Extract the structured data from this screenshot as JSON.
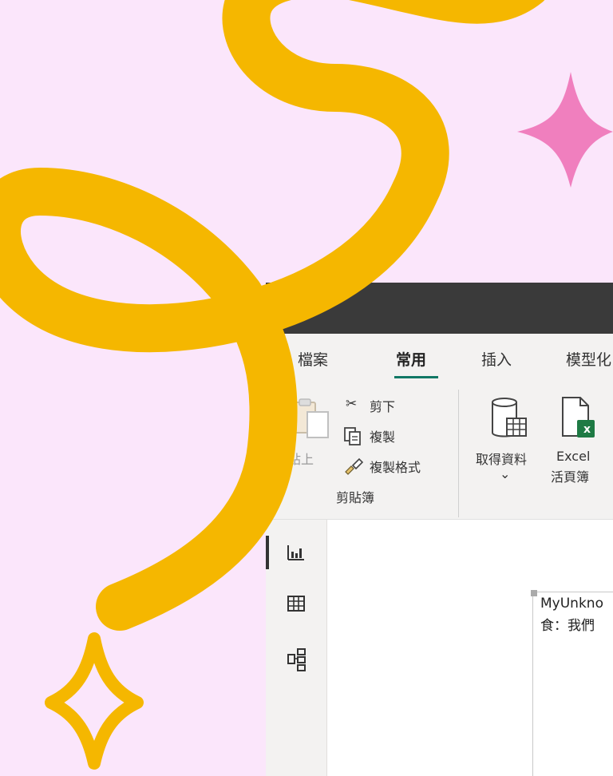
{
  "window": {
    "menu": [
      "檔案",
      "常用",
      "插入",
      "模型化"
    ],
    "active_tab": "常用"
  },
  "ribbon": {
    "paste_label": "貼上",
    "cut_label": "剪下",
    "copy_label": "複製",
    "format_painter_label": "複製格式",
    "clipboard_group_label": "剪貼簿",
    "get_data_label": "取得資料",
    "get_data_chevron": "⌄",
    "excel_label_1": "Excel",
    "excel_label_2": "活頁簿",
    "excel_badge": "x"
  },
  "rail": {
    "items": [
      "report-view",
      "data-view",
      "model-view"
    ]
  },
  "canvas": {
    "visual_line1": "MyUnkno",
    "visual_line2": "食：我們"
  },
  "colors": {
    "background": "#fbe6fb",
    "swirl": "#f5b700",
    "pink_star": "#f07fbe",
    "titlebar": "#3a3a3a",
    "ribbon": "#f3f2f1",
    "accent": "#117865",
    "excel_green": "#1e7a44"
  }
}
